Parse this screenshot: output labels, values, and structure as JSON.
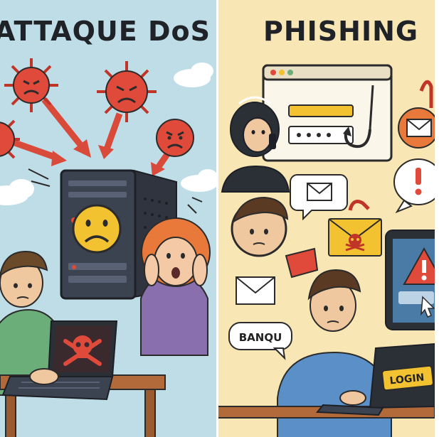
{
  "left_panel": {
    "title": "ATTAQUE DoS"
  },
  "right_panel": {
    "title": "PHISHING",
    "bank_label": "BANQU",
    "login_label": "LOGIN"
  },
  "colors": {
    "left_bg": "#bfdde6",
    "right_bg": "#f8e6b5",
    "virus": "#e04a3a",
    "server": "#3b4250",
    "warning": "#f2c230"
  },
  "icons": [
    "virus-icon",
    "angry-face-icon",
    "server-icon",
    "sad-face-icon",
    "skull-crossbones-icon",
    "fish-hook-icon",
    "envelope-icon",
    "exclamation-icon",
    "warning-triangle-icon",
    "cursor-icon",
    "star-icon"
  ]
}
